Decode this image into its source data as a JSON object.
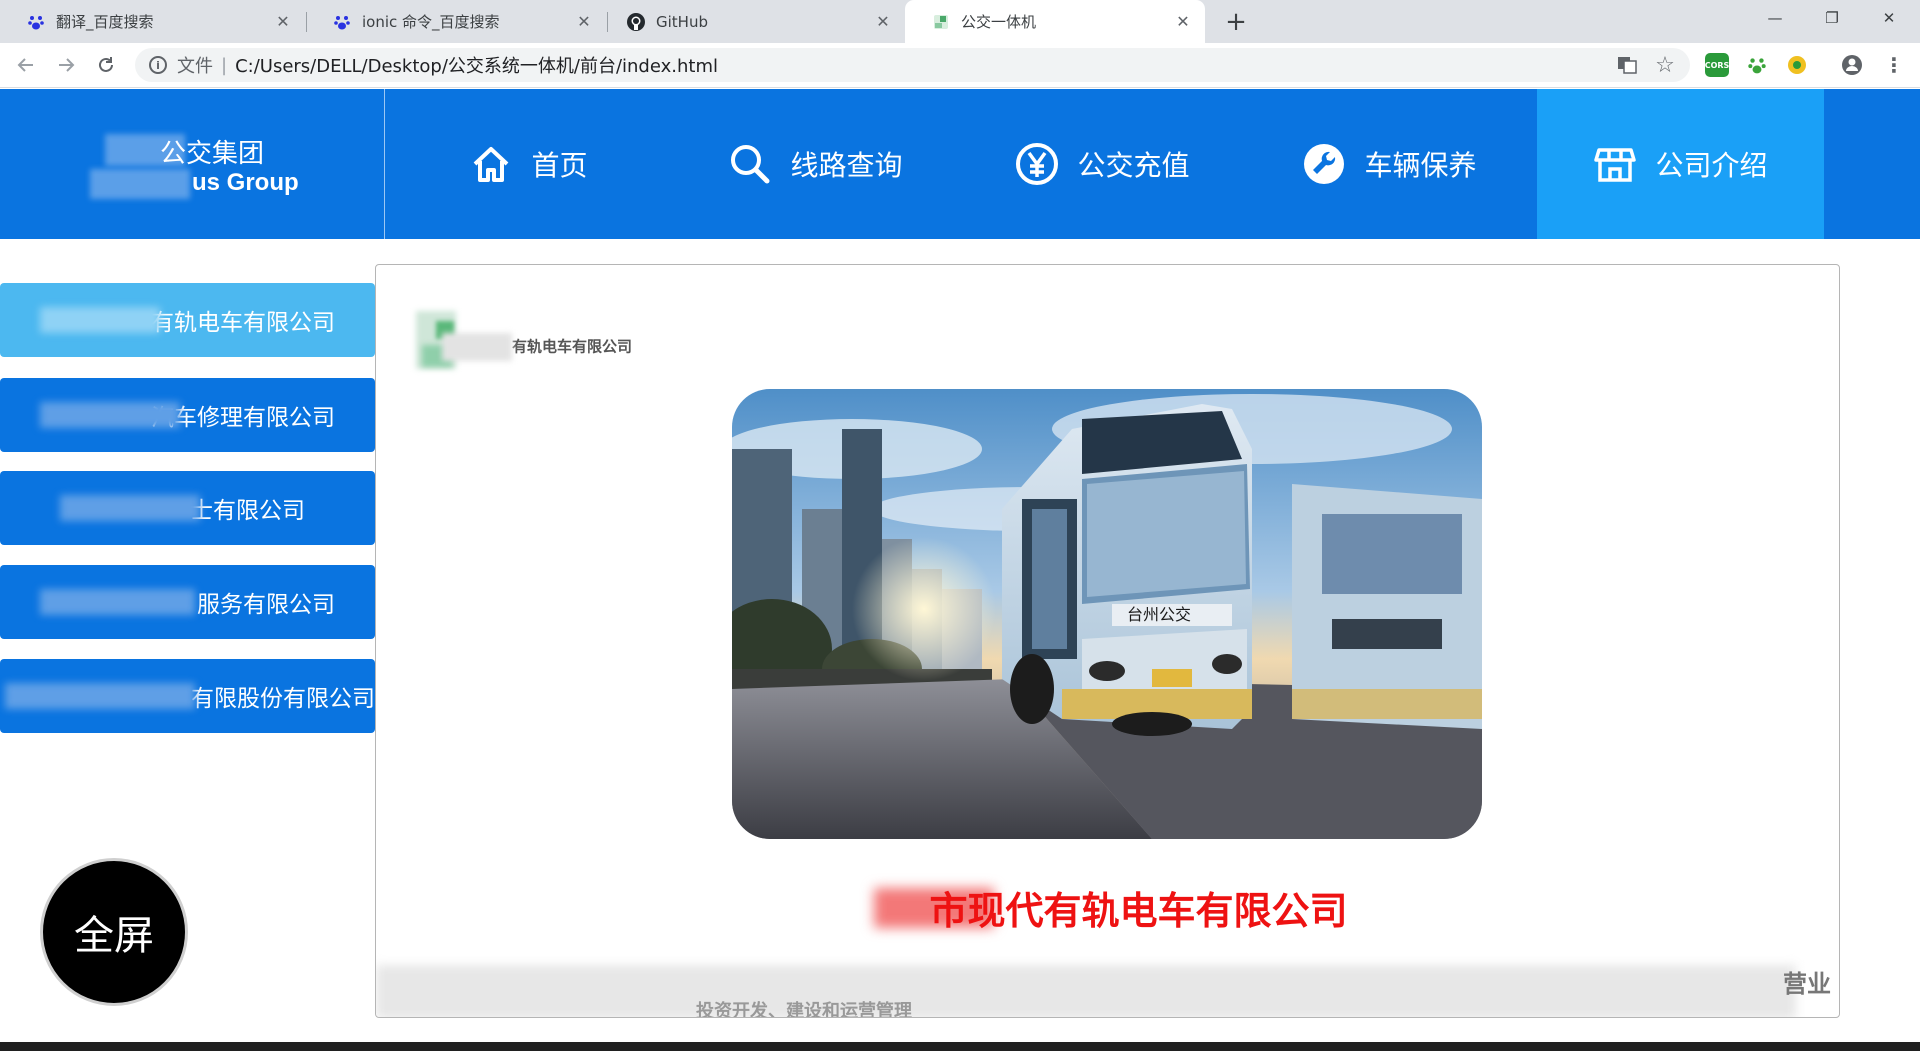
{
  "browser": {
    "tabs": [
      {
        "title": "翻译_百度搜索",
        "icon": "baidu-paw-icon"
      },
      {
        "title": "ionic 命令_百度搜索",
        "icon": "baidu-paw-icon"
      },
      {
        "title": "GitHub",
        "icon": "github-icon"
      },
      {
        "title": "公交一体机",
        "icon": "page-favicon-icon"
      }
    ],
    "address": {
      "scheme": "文件",
      "url": "C:/Users/DELL/Desktop/公交系统一体机/前台/index.html"
    }
  },
  "header": {
    "logo_line1": "公交集团",
    "logo_line2": "us Group",
    "nav": [
      {
        "label": "首页",
        "icon": "home-icon"
      },
      {
        "label": "线路查询",
        "icon": "search-icon"
      },
      {
        "label": "公交充值",
        "icon": "yen-icon"
      },
      {
        "label": "车辆保养",
        "icon": "wrench-icon"
      },
      {
        "label": "公司介绍",
        "icon": "store-icon"
      }
    ],
    "active_nav": 4,
    "colors": {
      "bar": "#0a74e0",
      "active": "#1aa0f7"
    }
  },
  "sidebar": {
    "items": [
      {
        "label": "有轨电车有限公司"
      },
      {
        "label": "汽车修理有限公司"
      },
      {
        "label": "士有限公司"
      },
      {
        "label": "服务有限公司"
      },
      {
        "label": "有限股份有限公司"
      }
    ],
    "active_index": 0
  },
  "content": {
    "company_small": "有轨电车有限公司",
    "headline": "市现代有轨电车有限公司",
    "intro_line1_end": "营业",
    "intro_line2_a": "投资开发、建设和运营管理",
    "headline_color": "#ee1212"
  },
  "fullscreen_label": "全屏"
}
